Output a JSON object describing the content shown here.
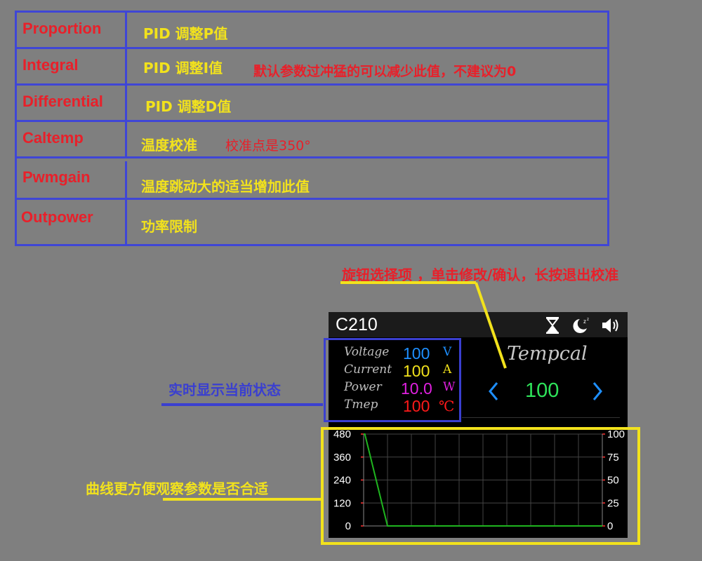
{
  "params": [
    {
      "name": "Proportion",
      "desc": "PID 调整P值",
      "note": ""
    },
    {
      "name": "Integral",
      "desc": "PID 调整I值",
      "note": "默认参数过冲猛的可以减少此值，不建议为0"
    },
    {
      "name": "Differential",
      "desc": "PID 调整D值",
      "note": ""
    },
    {
      "name": "Caltemp",
      "desc": "温度校准",
      "note": "校准点是350°"
    },
    {
      "name": "Pwmgain",
      "desc": "温度跳动大的适当增加此值",
      "note": ""
    },
    {
      "name": "Outpower",
      "desc": "功率限制",
      "note": ""
    }
  ],
  "annotations": {
    "knob": "旋钮选择项 ，单击修改/确认，长按退出校准",
    "status": "实时显示当前状态",
    "curve": "曲线更方便观察参数是否合适"
  },
  "device": {
    "model": "C210",
    "icons": [
      "hourglass-icon",
      "sleep-moon-icon",
      "speaker-icon"
    ],
    "stats": [
      {
        "label": "Voltage",
        "value": "100",
        "unit": "V",
        "color": "#1e8fff"
      },
      {
        "label": "Current",
        "value": "100",
        "unit": "A",
        "color": "#f2e21c"
      },
      {
        "label": "Power",
        "value": "10.0",
        "unit": "W",
        "color": "#e020e0"
      },
      {
        "label": "Tmep",
        "value": "100",
        "unit": "℃",
        "color": "#ff1a1a"
      }
    ],
    "menu": {
      "title": "Tempcal",
      "value": "100"
    }
  },
  "colors": {
    "table_border": "#3f46d6",
    "param_name": "#e8202a",
    "param_desc": "#f2e21c",
    "curve": "#1fb51f",
    "nav_arrow": "#1e8fff"
  },
  "chart_data": {
    "type": "line",
    "y_left_ticks": [
      "480",
      "360",
      "240",
      "120",
      "0"
    ],
    "y_right_ticks": [
      "100",
      "75",
      "50",
      "25",
      "0"
    ],
    "ylim_left": [
      0,
      480
    ],
    "ylim_right": [
      0,
      100
    ],
    "grid": true,
    "series": [
      {
        "x": [
          0,
          0.05,
          1,
          9.6,
          10
        ],
        "y": [
          480,
          480,
          0,
          0,
          0
        ]
      }
    ],
    "xlim": [
      0,
      10
    ]
  }
}
